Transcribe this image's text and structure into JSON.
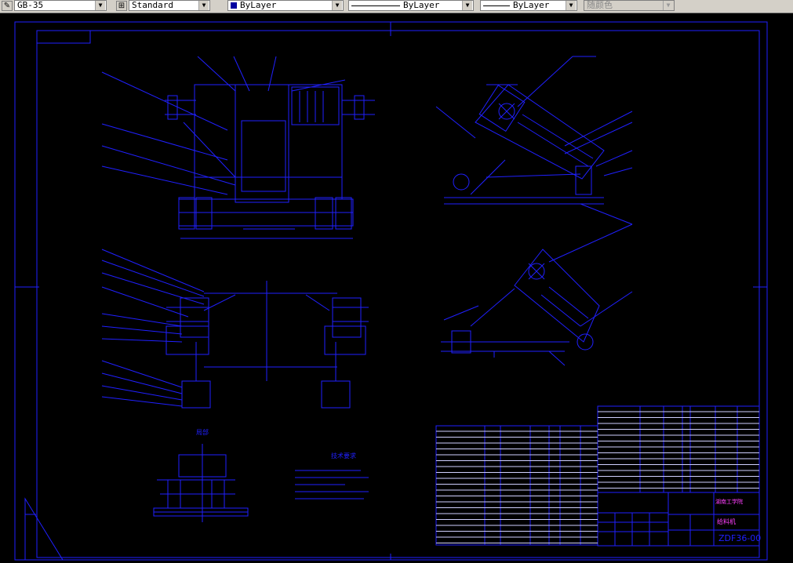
{
  "toolbar": {
    "text_style": "GB-35",
    "dim_style": "Standard",
    "layer_color": "ByLayer",
    "linetype": "ByLayer",
    "lineweight": "ByLayer",
    "plot_style": "随颜色"
  },
  "colors": {
    "drawing_line": "#2020ff",
    "title_text": "#ff40ff",
    "background": "#000000"
  },
  "drawing": {
    "tech_requirements_title": "技术要求",
    "detail_label": "局部",
    "title_block_company": "湖南工学院",
    "title_block_name": "给料机",
    "drawing_number": "ZDF36-00"
  }
}
